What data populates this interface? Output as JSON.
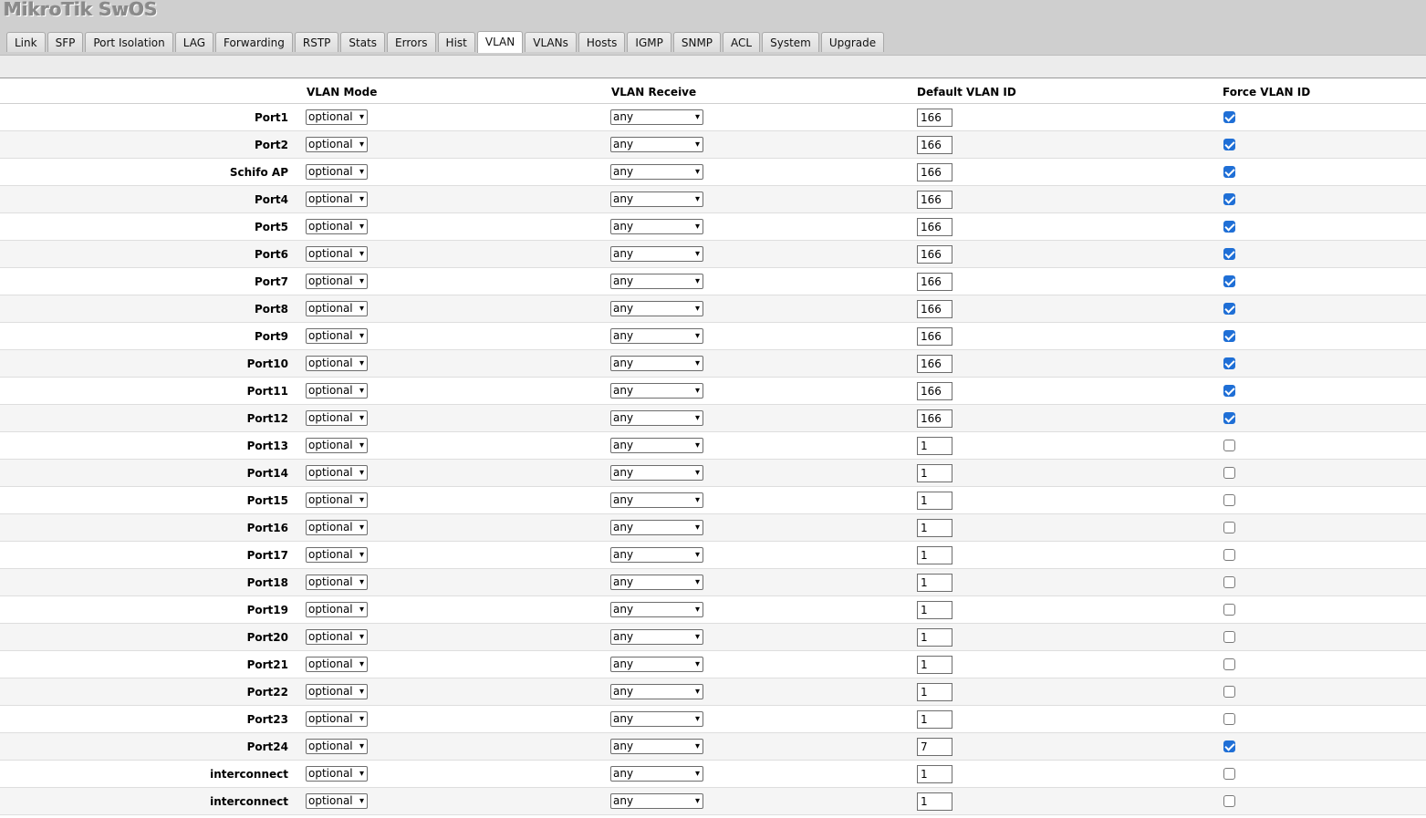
{
  "app": {
    "title": "MikroTik SwOS"
  },
  "tabs": [
    "Link",
    "SFP",
    "Port Isolation",
    "LAG",
    "Forwarding",
    "RSTP",
    "Stats",
    "Errors",
    "Hist",
    "VLAN",
    "VLANs",
    "Hosts",
    "IGMP",
    "SNMP",
    "ACL",
    "System",
    "Upgrade"
  ],
  "active_tab": "VLAN",
  "columns": {
    "mode": "VLAN Mode",
    "receive": "VLAN Receive",
    "default_id": "Default VLAN ID",
    "force": "Force VLAN ID"
  },
  "rows": [
    {
      "port": "Port1",
      "mode": "optional",
      "receive": "any",
      "vid": "166",
      "force": true
    },
    {
      "port": "Port2",
      "mode": "optional",
      "receive": "any",
      "vid": "166",
      "force": true
    },
    {
      "port": "Schifo AP",
      "mode": "optional",
      "receive": "any",
      "vid": "166",
      "force": true
    },
    {
      "port": "Port4",
      "mode": "optional",
      "receive": "any",
      "vid": "166",
      "force": true
    },
    {
      "port": "Port5",
      "mode": "optional",
      "receive": "any",
      "vid": "166",
      "force": true
    },
    {
      "port": "Port6",
      "mode": "optional",
      "receive": "any",
      "vid": "166",
      "force": true
    },
    {
      "port": "Port7",
      "mode": "optional",
      "receive": "any",
      "vid": "166",
      "force": true
    },
    {
      "port": "Port8",
      "mode": "optional",
      "receive": "any",
      "vid": "166",
      "force": true
    },
    {
      "port": "Port9",
      "mode": "optional",
      "receive": "any",
      "vid": "166",
      "force": true
    },
    {
      "port": "Port10",
      "mode": "optional",
      "receive": "any",
      "vid": "166",
      "force": true
    },
    {
      "port": "Port11",
      "mode": "optional",
      "receive": "any",
      "vid": "166",
      "force": true
    },
    {
      "port": "Port12",
      "mode": "optional",
      "receive": "any",
      "vid": "166",
      "force": true
    },
    {
      "port": "Port13",
      "mode": "optional",
      "receive": "any",
      "vid": "1",
      "force": false
    },
    {
      "port": "Port14",
      "mode": "optional",
      "receive": "any",
      "vid": "1",
      "force": false
    },
    {
      "port": "Port15",
      "mode": "optional",
      "receive": "any",
      "vid": "1",
      "force": false
    },
    {
      "port": "Port16",
      "mode": "optional",
      "receive": "any",
      "vid": "1",
      "force": false
    },
    {
      "port": "Port17",
      "mode": "optional",
      "receive": "any",
      "vid": "1",
      "force": false
    },
    {
      "port": "Port18",
      "mode": "optional",
      "receive": "any",
      "vid": "1",
      "force": false
    },
    {
      "port": "Port19",
      "mode": "optional",
      "receive": "any",
      "vid": "1",
      "force": false
    },
    {
      "port": "Port20",
      "mode": "optional",
      "receive": "any",
      "vid": "1",
      "force": false
    },
    {
      "port": "Port21",
      "mode": "optional",
      "receive": "any",
      "vid": "1",
      "force": false
    },
    {
      "port": "Port22",
      "mode": "optional",
      "receive": "any",
      "vid": "1",
      "force": false
    },
    {
      "port": "Port23",
      "mode": "optional",
      "receive": "any",
      "vid": "1",
      "force": false
    },
    {
      "port": "Port24",
      "mode": "optional",
      "receive": "any",
      "vid": "7",
      "force": true
    },
    {
      "port": "interconnect",
      "mode": "optional",
      "receive": "any",
      "vid": "1",
      "force": false
    },
    {
      "port": "interconnect",
      "mode": "optional",
      "receive": "any",
      "vid": "1",
      "force": false
    }
  ],
  "colors": {
    "checkbox_on": "#1f6fd6",
    "header_bg": "#cfcfcf"
  }
}
